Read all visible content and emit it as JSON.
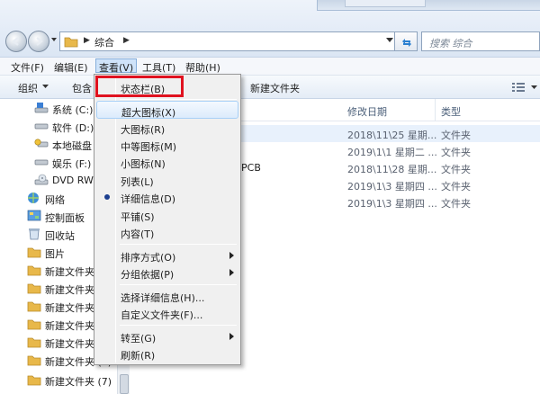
{
  "address": {
    "path": "综合",
    "search_placeholder": "搜索 综合"
  },
  "menubar": {
    "items": [
      {
        "label": "文件(F)"
      },
      {
        "label": "编辑(E)"
      },
      {
        "label": "查看(V)"
      },
      {
        "label": "工具(T)"
      },
      {
        "label": "帮助(H)"
      }
    ]
  },
  "toolbar": {
    "organize": "组织",
    "include": "包含",
    "new_folder": "新建文件夹"
  },
  "nav": {
    "items": [
      {
        "label": "系统 (C:)",
        "icon": "drive-system-icon"
      },
      {
        "label": "软件 (D:)",
        "icon": "drive-icon"
      },
      {
        "label": "本地磁盘",
        "icon": "drive-local-icon"
      },
      {
        "label": "娱乐 (F:)",
        "icon": "drive-icon"
      },
      {
        "label": "DVD RW",
        "icon": "dvd-drive-icon"
      },
      {
        "label": "网络",
        "icon": "network-icon"
      },
      {
        "label": "控制面板",
        "icon": "control-panel-icon"
      },
      {
        "label": "回收站",
        "icon": "recycle-bin-icon"
      },
      {
        "label": "图片",
        "icon": "folder-icon"
      },
      {
        "label": "新建文件夹",
        "icon": "folder-icon"
      },
      {
        "label": "新建文件夹",
        "icon": "folder-icon"
      },
      {
        "label": "新建文件夹",
        "icon": "folder-icon"
      },
      {
        "label": "新建文件夹",
        "icon": "folder-icon"
      },
      {
        "label": "新建文件夹",
        "icon": "folder-icon"
      },
      {
        "label": "新建文件夹 (6)",
        "icon": "folder-icon"
      },
      {
        "label": "新建文件夹 (7)",
        "icon": "folder-icon"
      }
    ]
  },
  "content": {
    "columns": {
      "modified": "修改日期",
      "type": "类型"
    },
    "rows": [
      {
        "name": "",
        "modified": "2018\\11\\25 星期...",
        "type": "文件夹"
      },
      {
        "name": "",
        "modified": "2019\\1\\1 星期二 ...",
        "type": "文件夹"
      },
      {
        "name": "PCB",
        "modified": "2018\\11\\28 星期...",
        "type": "文件夹"
      },
      {
        "name": "",
        "modified": "2019\\1\\3 星期四 ...",
        "type": "文件夹"
      },
      {
        "name": "",
        "modified": "2019\\1\\3 星期四 ...",
        "type": "文件夹"
      }
    ]
  },
  "view_menu": {
    "status_bar": "状态栏(B)",
    "extra_large_icons": "超大图标(X)",
    "large_icons": "大图标(R)",
    "medium_icons": "中等图标(M)",
    "small_icons": "小图标(N)",
    "list": "列表(L)",
    "details": "详细信息(D)",
    "tiles": "平铺(S)",
    "content": "内容(T)",
    "sort_by": "排序方式(O)",
    "group_by": "分组依据(P)",
    "choose_details": "选择详细信息(H)...",
    "customize_folder": "自定义文件夹(F)...",
    "go_to": "转至(G)",
    "refresh": "刷新(R)"
  },
  "colors": {
    "highlight_box": "#e0121f",
    "menu_hover": "#dcebfc",
    "folder": "#e8b84a"
  }
}
